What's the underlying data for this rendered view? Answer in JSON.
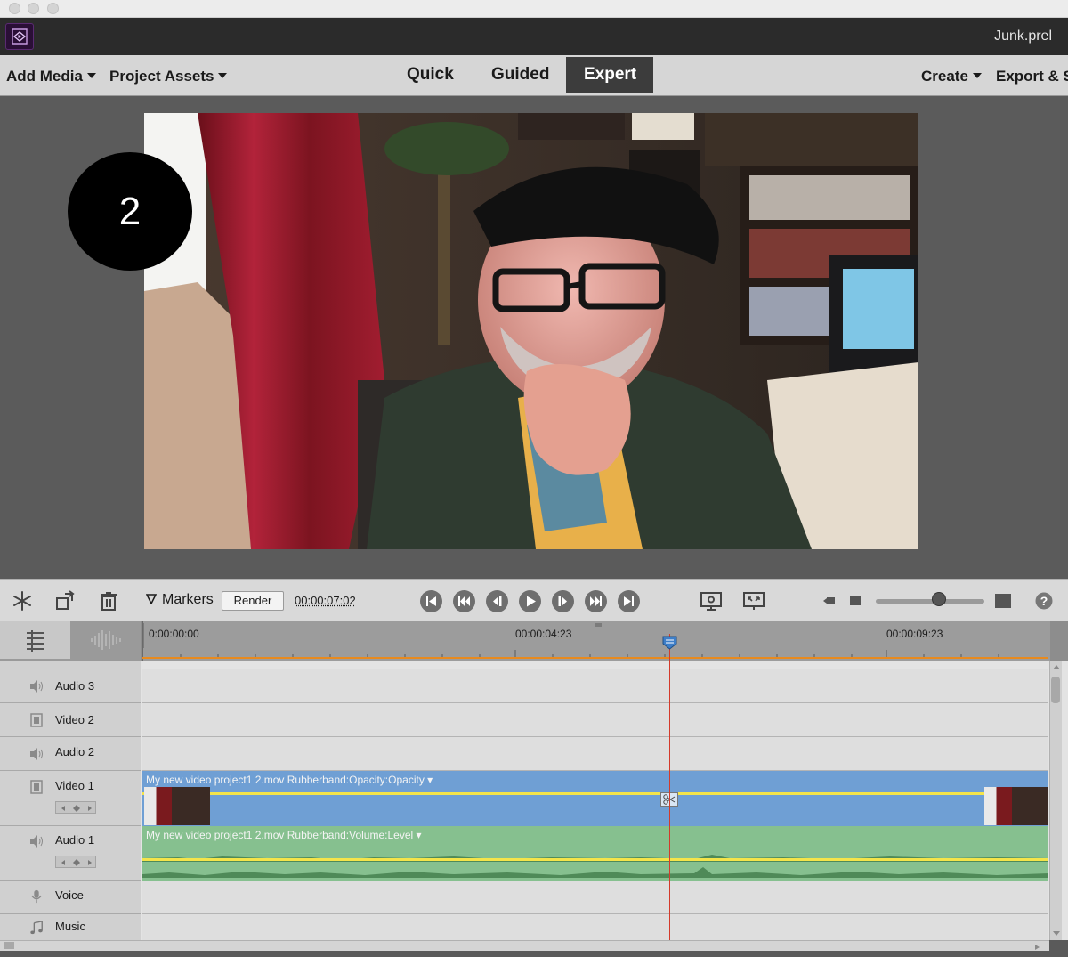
{
  "window": {
    "file_name": "Junk.prel"
  },
  "menu": {
    "add_media": "Add Media",
    "project_assets": "Project Assets",
    "create": "Create",
    "export_share": "Export & S"
  },
  "modes": {
    "quick": "Quick",
    "guided": "Guided",
    "expert": "Expert",
    "active": "Expert"
  },
  "monitor": {
    "step_number": "2"
  },
  "toolbar": {
    "markers_label": "Markers",
    "render_label": "Render",
    "timecode": "00:00:07:02",
    "zoom_level": 0.58,
    "icons": [
      "freeze-frame-icon",
      "rotate-icon",
      "trash-icon",
      "marker-icon",
      "go-to-start-icon",
      "rewind-icon",
      "step-back-icon",
      "play-icon",
      "step-forward-icon",
      "fast-forward-icon",
      "go-to-end-icon",
      "monitor-settings-icon",
      "fit-icon",
      "zoom-out-icon",
      "zoom-in-icon",
      "help-icon"
    ]
  },
  "timeline": {
    "ruler_marks": [
      "0:00:00:00",
      "00:00:04:23",
      "00:00:09:23"
    ],
    "playhead_timecode": "00:00:07:02",
    "tracks": [
      {
        "name": "Audio 3",
        "type": "audio",
        "expanded": false
      },
      {
        "name": "Video 2",
        "type": "video",
        "expanded": false
      },
      {
        "name": "Audio 2",
        "type": "audio",
        "expanded": false
      },
      {
        "name": "Video 1",
        "type": "video",
        "expanded": true
      },
      {
        "name": "Audio 1",
        "type": "audio",
        "expanded": true
      },
      {
        "name": "Voice",
        "type": "voice",
        "expanded": false
      },
      {
        "name": "Music",
        "type": "music",
        "expanded": false
      }
    ],
    "clips": {
      "video1": {
        "label": "My new video project1 2.mov Rubberband:Opacity:Opacity ▾",
        "color": "#6f9fd4"
      },
      "audio1": {
        "label": "My new video project1 2.mov Rubberband:Volume:Level ▾",
        "color": "#86c08f"
      }
    }
  },
  "colors": {
    "accent_orange": "#e88a1e",
    "playhead": "#d43a2a",
    "rubberband": "#f4e44a"
  }
}
